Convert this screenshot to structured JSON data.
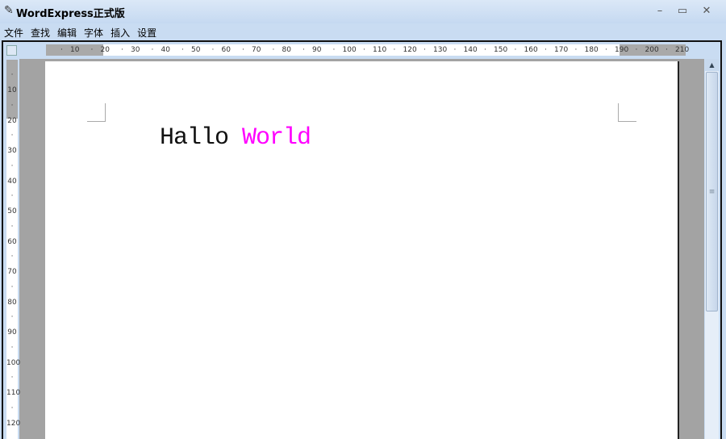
{
  "window": {
    "title": "WordExpress正式版",
    "minimize": "–",
    "maximize": "▭",
    "close": "✕"
  },
  "menu": [
    "文件",
    "查找",
    "编辑",
    "字体",
    "插入",
    "设置"
  ],
  "ruler": {
    "horizontal": [
      "10",
      "20",
      "30",
      "40",
      "50",
      "60",
      "70",
      "80",
      "90",
      "100",
      "110",
      "120",
      "130",
      "140",
      "150",
      "160",
      "170",
      "180",
      "190",
      "200",
      "210"
    ],
    "vertical": [
      "10",
      "20",
      "30",
      "40",
      "50",
      "60",
      "70",
      "80",
      "90",
      "100",
      "110",
      "120"
    ]
  },
  "document": {
    "word1": "Hallo",
    "word2": "World",
    "word2_color": "#ff00ff"
  }
}
